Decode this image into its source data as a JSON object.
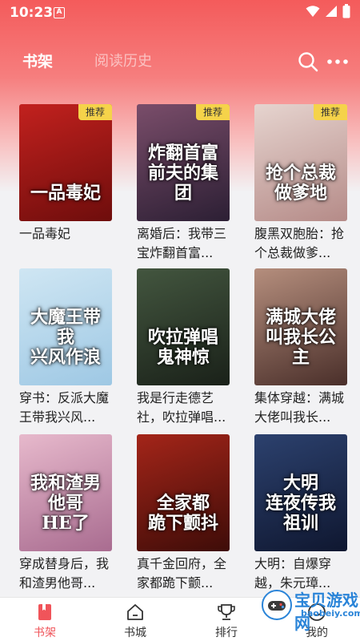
{
  "status_bar": {
    "time": "10:23",
    "notif_glyph": "A"
  },
  "header": {
    "tabs": [
      {
        "label": "书架"
      },
      {
        "label": "阅读历史"
      }
    ]
  },
  "books": [
    {
      "title": "一品毒妃",
      "cover_text": "一品毒妃",
      "badge": "推荐",
      "colors": [
        "#c2211e",
        "#6e0d0c"
      ]
    },
    {
      "title": "离婚后：我带三宝炸翻首富...",
      "cover_text": "炸翻首富\n前夫的集团",
      "badge": "推荐",
      "colors": [
        "#7a4d6a",
        "#2c1f34"
      ]
    },
    {
      "title": "腹黑双胞胎：抢个总裁做爹...",
      "cover_text": "抢个总裁\n做爹地",
      "badge": "推荐",
      "colors": [
        "#e6d4cf",
        "#b58b88"
      ]
    },
    {
      "title": "穿书：反派大魔王带我兴风...",
      "cover_text": "大魔王带我\n兴风作浪",
      "badge": "",
      "colors": [
        "#cfe6f3",
        "#9ec8e4"
      ]
    },
    {
      "title": "我是行走德艺社，吹拉弹唱...",
      "cover_text": "吹拉弹唱\n鬼神惊",
      "badge": "",
      "colors": [
        "#43563f",
        "#1a2119"
      ]
    },
    {
      "title": "集体穿越：满城大佬叫我长...",
      "cover_text": "满城大佬\n叫我长公主",
      "badge": "",
      "colors": [
        "#b58e7d",
        "#4a2f2a"
      ]
    },
    {
      "title": "穿成替身后，我和渣男他哥...",
      "cover_text": "我和渣男他哥\nHE了",
      "badge": "",
      "colors": [
        "#e7b9cc",
        "#a96c90"
      ]
    },
    {
      "title": "真千金回府，全家都跪下颤...",
      "cover_text": "全家都\n跪下颤抖",
      "badge": "",
      "colors": [
        "#a42519",
        "#3e0c08"
      ]
    },
    {
      "title": "大明：自爆穿越，朱元璋...",
      "cover_text": "大明\n连夜传我祖训",
      "badge": "",
      "colors": [
        "#2c416e",
        "#0f1730"
      ]
    }
  ],
  "bottom_nav": [
    {
      "label": "书架",
      "icon": "bookshelf-icon",
      "active": true
    },
    {
      "label": "书城",
      "icon": "store-icon",
      "active": false
    },
    {
      "label": "排行",
      "icon": "trophy-icon",
      "active": false
    },
    {
      "label": "我的",
      "icon": "profile-icon",
      "active": false
    }
  ],
  "watermark": {
    "text": "宝贝游戏网",
    "url": "baobeiy.com"
  },
  "colors": {
    "accent": "#f0545a",
    "header": "#f45b5b",
    "badge": "#f5d34a"
  }
}
